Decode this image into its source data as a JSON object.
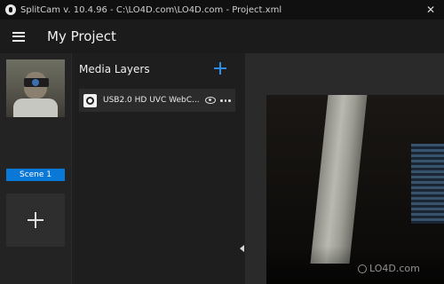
{
  "window": {
    "title": "SplitCam v. 10.4.96 - C:\\LO4D.com\\LO4D.com - Project.xml",
    "close_glyph": "✕"
  },
  "header": {
    "menu_icon": "hamburger-menu-icon",
    "project_title": "My Project"
  },
  "scenes": {
    "items": [
      {
        "label": "Scene 1",
        "active": true
      }
    ],
    "add_icon": "plus-icon"
  },
  "media_layers": {
    "title": "Media Layers",
    "add_icon": "plus-icon",
    "accent_color": "#2e8de6",
    "items": [
      {
        "name": "USB2.0 HD UVC WebC...",
        "icon": "webcam-icon",
        "visibility_icon": "eye-icon",
        "more_icon": "more-options-icon"
      }
    ]
  },
  "watermark": {
    "text": "LO4D.com"
  },
  "colors": {
    "accent": "#0a78d7",
    "background": "#1e1e1e"
  }
}
